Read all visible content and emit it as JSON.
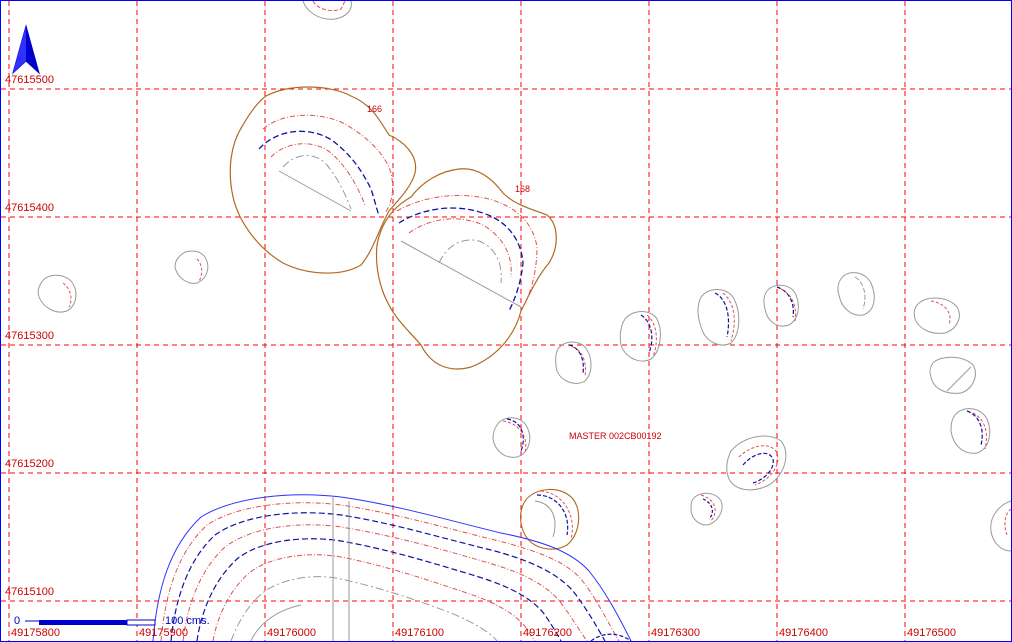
{
  "map": {
    "north_arrow_icon": "north-arrow-icon",
    "grid": {
      "y_labels": [
        "47615500",
        "47615400",
        "47615300",
        "47615200",
        "47615100"
      ],
      "x_labels": [
        "49175800",
        "49175900",
        "49176000",
        "49176100",
        "49176200",
        "49176300",
        "49176400",
        "49176500"
      ]
    },
    "features": {
      "label_166": "166",
      "label_168": "168",
      "master_label": "MASTER 002CB00192"
    },
    "scale_bar": {
      "zero_label": "0",
      "length_label": "100 cms."
    },
    "colors": {
      "grid_line": "#ff0000",
      "grid_text": "#cc0000",
      "frame": "#0000ff",
      "polygon_outline": "#b06a20",
      "contour_red": "#e05050",
      "contour_blue": "#1010a0",
      "contour_gray": "#9a9a9a",
      "scale_bar": "#0000cc"
    }
  }
}
